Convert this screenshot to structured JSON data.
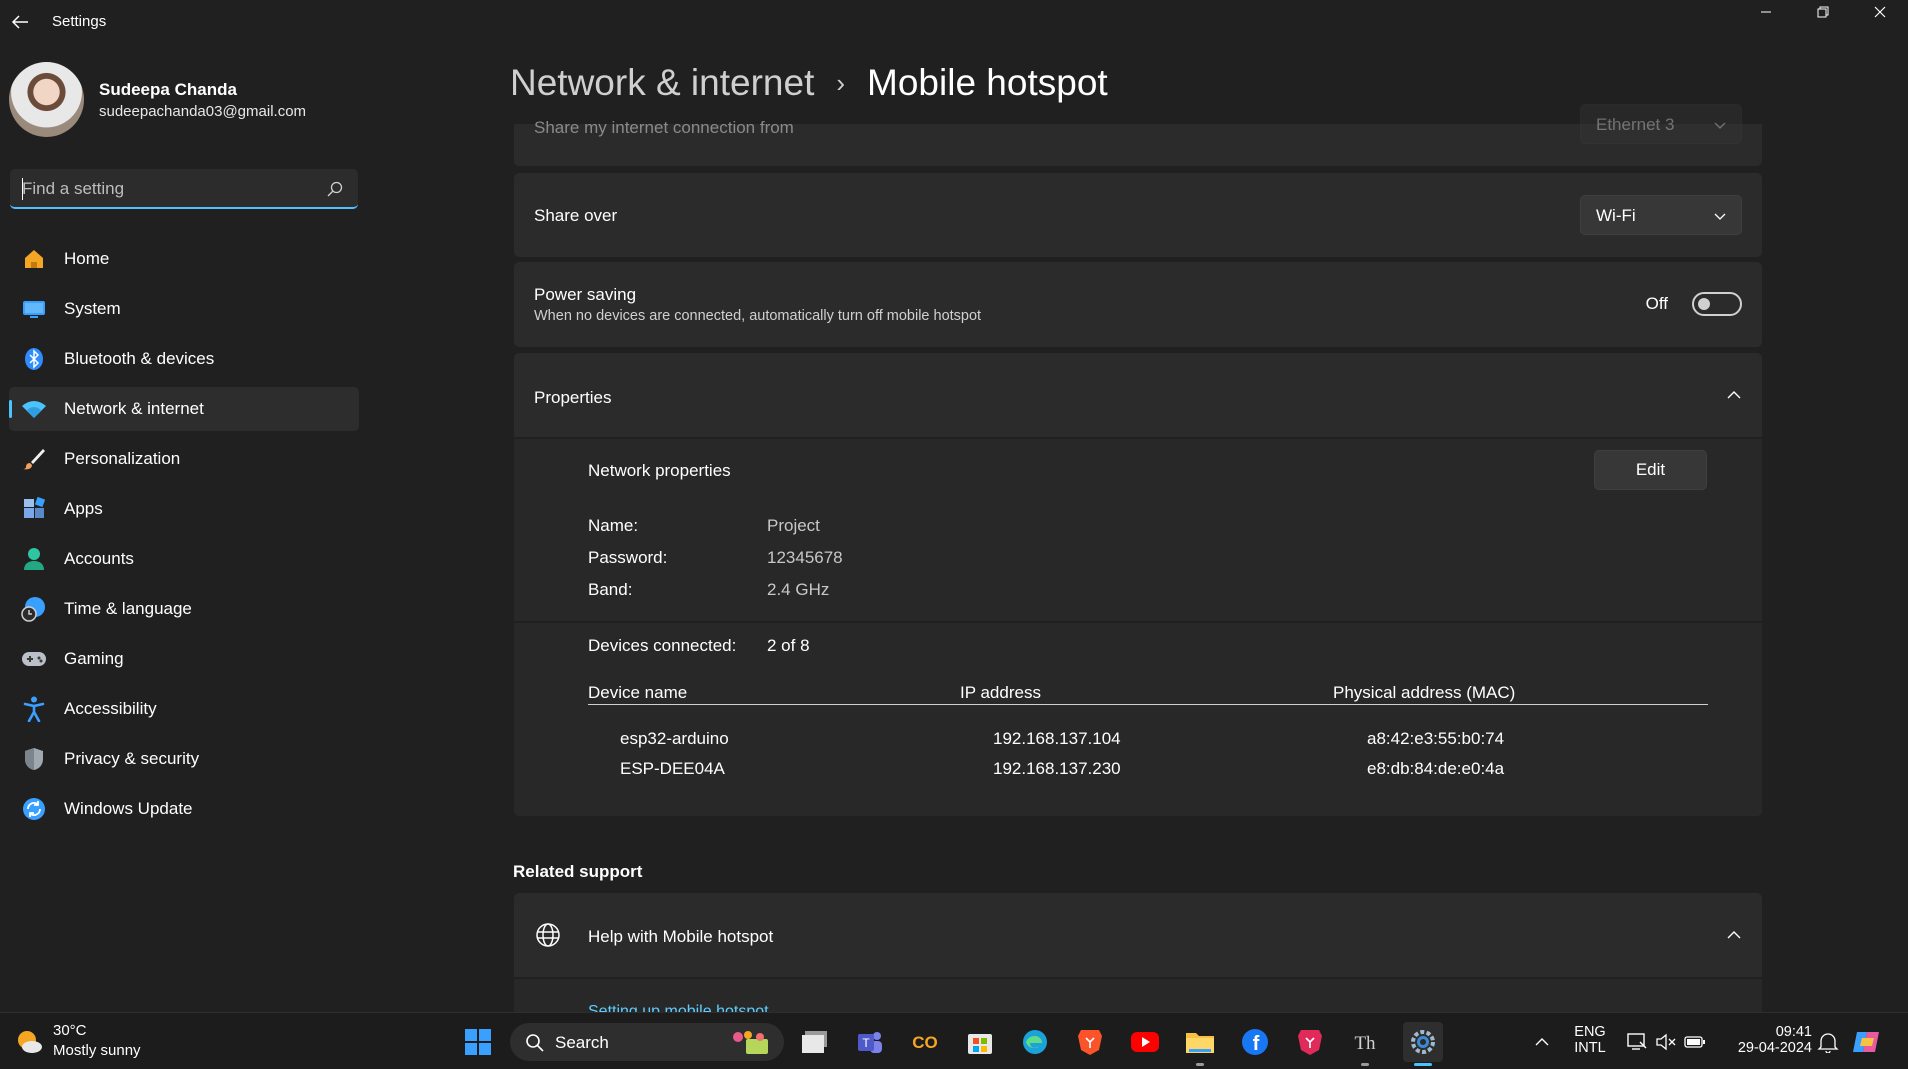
{
  "window": {
    "app_title": "Settings"
  },
  "profile": {
    "name": "Sudeepa Chanda",
    "email": "sudeepachanda03@gmail.com"
  },
  "search": {
    "placeholder": "Find a setting"
  },
  "nav": [
    {
      "label": "Home",
      "icon": "home-icon",
      "color": "#f5a623"
    },
    {
      "label": "System",
      "icon": "system-icon",
      "color": "#3aa0ff"
    },
    {
      "label": "Bluetooth & devices",
      "icon": "bluetooth-icon",
      "color": "#2f8cff"
    },
    {
      "label": "Network & internet",
      "icon": "wifi-icon",
      "color": "#4cc2ff",
      "active": true
    },
    {
      "label": "Personalization",
      "icon": "brush-icon",
      "color": "#f0a060"
    },
    {
      "label": "Apps",
      "icon": "apps-icon",
      "color": "#7aa8e8"
    },
    {
      "label": "Accounts",
      "icon": "accounts-icon",
      "color": "#2ec6a0"
    },
    {
      "label": "Time & language",
      "icon": "globe-clock-icon",
      "color": "#3aa0ff"
    },
    {
      "label": "Gaming",
      "icon": "gamepad-icon",
      "color": "#b9c0c8"
    },
    {
      "label": "Accessibility",
      "icon": "accessibility-icon",
      "color": "#3aa0ff"
    },
    {
      "label": "Privacy & security",
      "icon": "shield-icon",
      "color": "#a0a8b0"
    },
    {
      "label": "Windows Update",
      "icon": "update-icon",
      "color": "#3aa0ff"
    }
  ],
  "breadcrumb": {
    "parent": "Network & internet",
    "separator": "›",
    "current": "Mobile hotspot"
  },
  "share_from": {
    "label": "Share my internet connection from",
    "value": "Ethernet 3"
  },
  "share_over": {
    "label": "Share over",
    "value": "Wi-Fi"
  },
  "power_saving": {
    "label": "Power saving",
    "description": "When no devices are connected, automatically turn off mobile hotspot",
    "state": "Off"
  },
  "properties": {
    "title": "Properties",
    "network_properties_label": "Network properties",
    "edit_label": "Edit",
    "name_key": "Name:",
    "name_value": "Project",
    "password_key": "Password:",
    "password_value": "12345678",
    "band_key": "Band:",
    "band_value": "2.4 GHz",
    "devices_key": "Devices connected:",
    "devices_value": "2 of 8",
    "columns": [
      "Device name",
      "IP address",
      "Physical address (MAC)"
    ],
    "devices": [
      {
        "name": "esp32-arduino",
        "ip": "192.168.137.104",
        "mac": "a8:42:e3:55:b0:74"
      },
      {
        "name": "ESP-DEE04A",
        "ip": "192.168.137.230",
        "mac": "e8:db:84:de:e0:4a"
      }
    ]
  },
  "related_support": {
    "heading": "Related support",
    "help_label": "Help with Mobile hotspot",
    "link_label": "Setting up mobile hotspot"
  },
  "taskbar": {
    "weather_temp": "30°C",
    "weather_desc": "Mostly sunny",
    "search_label": "Search",
    "lang_line1": "ENG",
    "lang_line2": "INTL",
    "time": "09:41",
    "date": "29-04-2024",
    "accent": "#4cc2ff"
  }
}
